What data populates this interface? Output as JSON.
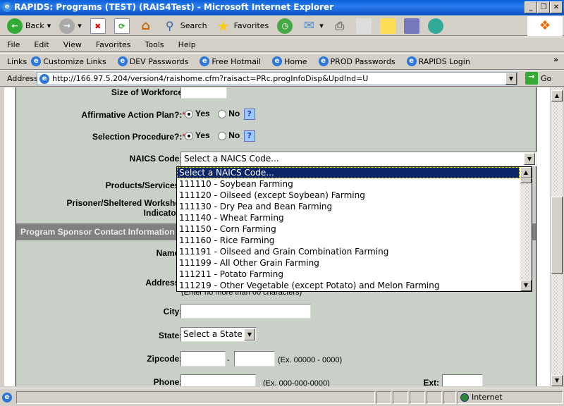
{
  "window": {
    "title": "RAPIDS: Programs  (TEST) (RAIS4Test) - Microsoft Internet Explorer",
    "minimize": "_",
    "restore": "❐",
    "close": "✕"
  },
  "toolbar": {
    "back": "Back",
    "search": "Search",
    "favorites": "Favorites"
  },
  "menu": [
    "File",
    "Edit",
    "View",
    "Favorites",
    "Tools",
    "Help"
  ],
  "links": {
    "label": "Links",
    "items": [
      "Customize Links",
      "DEV Passwords",
      "Free Hotmail",
      "Home",
      "PROD Passwords",
      "RAPIDS Login"
    ],
    "more": "»"
  },
  "address": {
    "label": "Address",
    "url": "http://166.97.5.204/version4/raishome.cfm?raisact=PRc.progInfoDisp&UpdInd=U",
    "go": "Go"
  },
  "form": {
    "workforce_label": "Size of Workforce:",
    "affirmative_label": "Affirmative Action Plan?:",
    "selection_label": "Selection Procedure?:",
    "yes": "Yes",
    "no": "No",
    "help": "?",
    "req": "*",
    "naics_label": "NAICS Code:",
    "naics_value": "Select a NAICS Code...",
    "products_label": "Products/Services:",
    "prisoner_label1": "Prisoner/Sheltered Workshop",
    "prisoner_label2": "Indicator:",
    "section": "Program Sponsor Contact Information",
    "name_label": "Name:",
    "address_label": "Address:",
    "address_hint": "(Enter no more than 60 characters)",
    "city_label": "City:",
    "state_label": "State:",
    "state_value": "Select a State",
    "zip_label": "Zipcode:",
    "zip_sep": "-",
    "zip_hint": "(Ex. 00000 - 0000)",
    "phone_label": "Phone:",
    "phone_hint": "(Ex. 000-000-0000)",
    "ext_label": "Ext:"
  },
  "naics_options": [
    "Select a NAICS Code...",
    "111110 - Soybean Farming",
    "111120 - Oilseed (except Soybean) Farming",
    "111130 - Dry Pea and Bean Farming",
    "111140 - Wheat Farming",
    "111150 - Corn Farming",
    "111160 - Rice Farming",
    "111191 - Oilseed and Grain Combination Farming",
    "111199 - All Other Grain Farming",
    "111211 - Potato Farming",
    "111219 - Other Vegetable (except Potato) and Melon Farming"
  ],
  "status": {
    "zone": "Internet"
  }
}
